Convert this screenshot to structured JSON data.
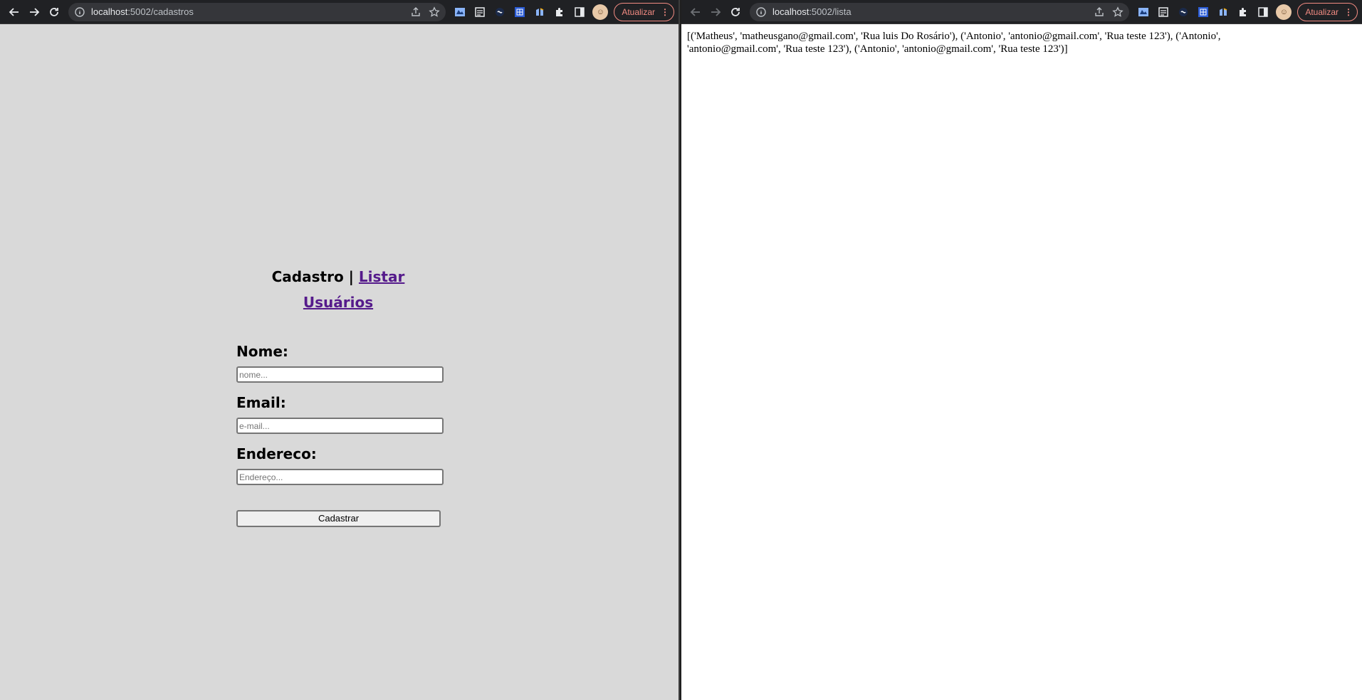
{
  "left_window": {
    "url_host": "localhost",
    "url_path": ":5002/cadastros",
    "update_label": "Atualizar",
    "page": {
      "heading_text": "Cadastro |",
      "heading_link": "Listar Usuários",
      "fields": [
        {
          "label": "Nome:",
          "placeholder": "nome..."
        },
        {
          "label": "Email:",
          "placeholder": "e-mail..."
        },
        {
          "label": "Endereco:",
          "placeholder": "Endereço..."
        }
      ],
      "submit_label": "Cadastrar"
    }
  },
  "right_window": {
    "url_host": "localhost",
    "url_path": ":5002/lista",
    "update_label": "Atualizar",
    "page": {
      "raw_text": "[('Matheus', 'matheusgano@gmail.com', 'Rua luis Do Rosário'), ('Antonio', 'antonio@gmail.com', 'Rua teste 123'), ('Antonio', 'antonio@gmail.com', 'Rua teste 123'), ('Antonio', 'antonio@gmail.com', 'Rua teste 123')]"
    }
  },
  "colors": {
    "left_page_bg": "#d9d9d9",
    "link": "#551a8b",
    "update_accent": "#f28b82"
  }
}
